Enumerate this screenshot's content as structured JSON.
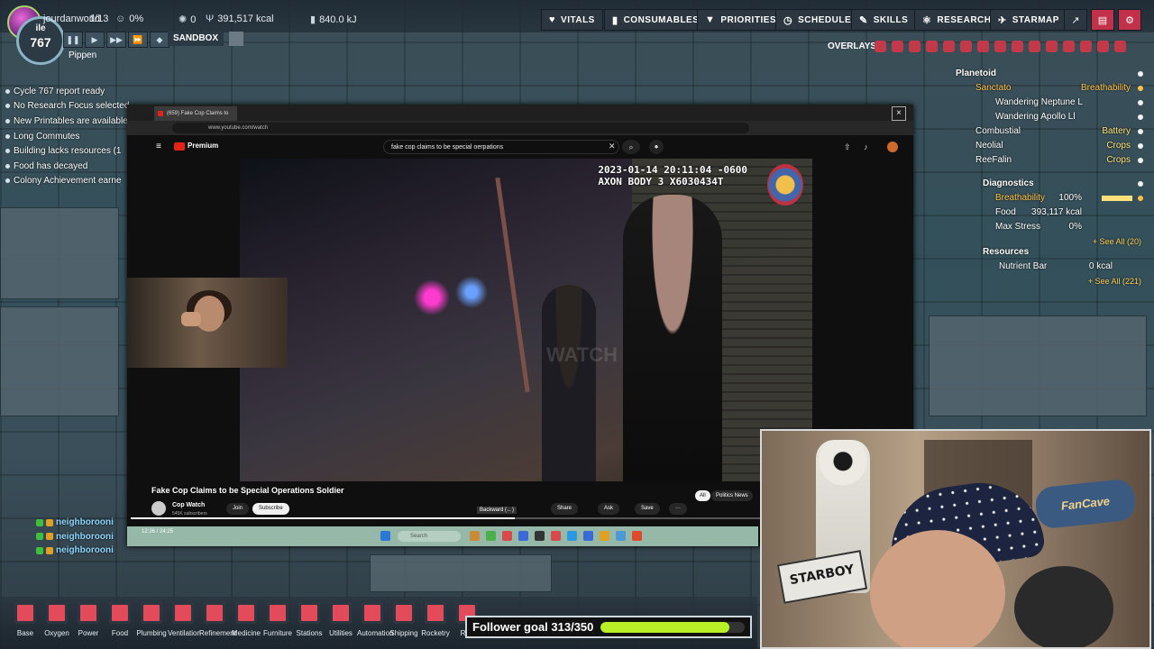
{
  "hud": {
    "user": "jourdanworld",
    "dupes": "1/13",
    "stress": "0%",
    "sick": "0",
    "calories": "391,517 kcal",
    "power": "840.0 kJ",
    "cycle": "767",
    "cycle_label": "ile",
    "sandbox": "SANDBOX",
    "dupe_name": "Pippen",
    "menus": [
      "VITALS",
      "CONSUMABLES",
      "PRIORITIES",
      "SCHEDULE",
      "SKILLS",
      "RESEARCH",
      "STARMAP"
    ],
    "overlays": "OVERLAYS"
  },
  "reports": [
    "Cycle 767 report ready",
    "No Research Focus selected",
    "New Printables are available",
    "Long Commutes",
    "Building lacks resources (1",
    "Food has decayed",
    "Colony Achievement earne"
  ],
  "right_panel": {
    "planetoid_head": "Planetoid",
    "planets": [
      {
        "name": "Sanctato",
        "status": "Breathability"
      },
      {
        "name": "Wandering Neptune L",
        "status": ""
      },
      {
        "name": "Wandering Apollo Ll",
        "status": ""
      },
      {
        "name": "Combustial",
        "status": "Battery"
      },
      {
        "name": "Neolial",
        "status": "Crops"
      },
      {
        "name": "ReeFalin",
        "status": "Crops"
      }
    ],
    "diagnostics_head": "Diagnostics",
    "diagnostics": [
      {
        "name": "Breathability",
        "value": "100%"
      },
      {
        "name": "Food",
        "value": "393,117 kcal"
      },
      {
        "name": "Max Stress",
        "value": "0%"
      }
    ],
    "diag_see_all": "+ See All (20)",
    "resources_head": "Resources",
    "resources": [
      {
        "name": "Nutrient Bar",
        "value": "0 kcal"
      }
    ],
    "res_see_all": "+ See All (221)"
  },
  "browser": {
    "tab_title": "(659) Fake Cop Claims to",
    "url": "www.youtube.com/watch",
    "brand": "Premium",
    "search_value": "fake cop claims to be special oerpations",
    "video_timestamp": "2023-01-14 20:11:04 -0600",
    "video_device": "AXON BODY 3 X6030434T",
    "video_watermark": "WATCH",
    "video_title": "Fake Cop Claims to be Special Operations Soldier",
    "channel": "Cop Watch",
    "channel_subs": "545K subscribers",
    "join": "Join",
    "subscribe": "Subscribe",
    "tooltip": "Backward (←)",
    "actions": [
      "Share",
      "Ask",
      "Save",
      "···"
    ],
    "chips": [
      "All",
      "Politics News"
    ],
    "progress": 0.56,
    "taskbar_time": "12:26 / 24:25",
    "taskbar_search": "Search"
  },
  "chat": [
    {
      "user": "neighborooni"
    },
    {
      "user": "neighborooni"
    },
    {
      "user": "neighborooni"
    }
  ],
  "streamcam": {
    "plate": "STARBOY",
    "sign": "FanCave"
  },
  "build_menu": [
    "Base",
    "Oxygen",
    "Power",
    "Food",
    "Plumbing",
    "Ventilation",
    "Refinement",
    "Medicine",
    "Furniture",
    "Stations",
    "Utilities",
    "Automation",
    "Shipping",
    "Rocketry",
    "Rad"
  ],
  "follower_goal": {
    "label": "Follower goal 313/350",
    "current": 313,
    "target": 350
  },
  "colors": {
    "accent_green": "#b8f028",
    "youtube_red": "#e62117",
    "warn_orange": "#ffc247",
    "status_yellow": "#ffe07a"
  }
}
